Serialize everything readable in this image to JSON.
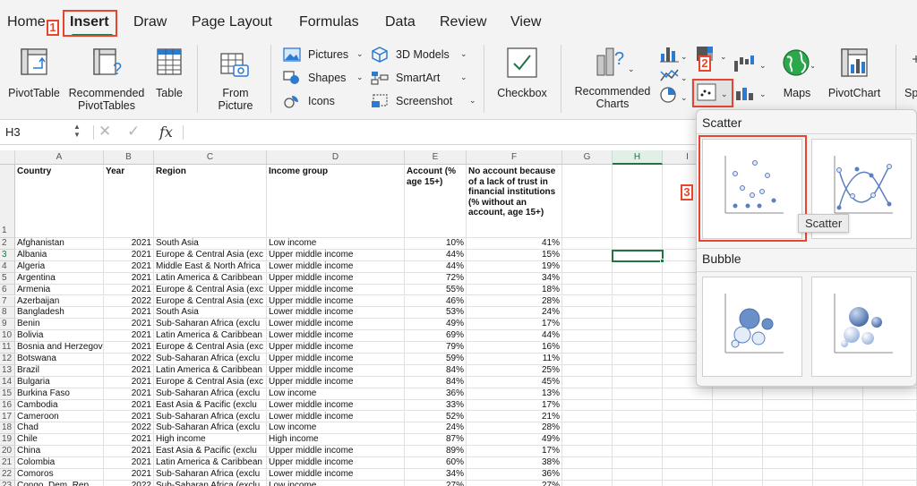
{
  "tabs": [
    "Home",
    "Insert",
    "Draw",
    "Page Layout",
    "Formulas",
    "Data",
    "Review",
    "View"
  ],
  "ribbon": {
    "pivot_table": "PivotTable",
    "recommended_pivot_1": "Recommended",
    "recommended_pivot_2": "PivotTables",
    "table": "Table",
    "from_picture_1": "From",
    "from_picture_2": "Picture",
    "pictures": "Pictures",
    "shapes": "Shapes",
    "icons": "Icons",
    "models_3d": "3D Models",
    "smartart": "SmartArt",
    "screenshot": "Screenshot",
    "checkbox": "Checkbox",
    "recommended_charts_1": "Recommended",
    "recommended_charts_2": "Charts",
    "maps": "Maps",
    "pivot_chart": "PivotChart",
    "sp": "Sp"
  },
  "formula_bar": {
    "name_box": "H3",
    "fx": "fx"
  },
  "columns": [
    "A",
    "B",
    "C",
    "D",
    "E",
    "F",
    "G",
    "H",
    "I"
  ],
  "headers": {
    "country": "Country",
    "year": "Year",
    "region": "Region",
    "income": "Income group",
    "account": "Account (% age 15+)",
    "no_account": "No account because of a lack of trust in financial institutions (% without an account, age 15+)"
  },
  "rows": [
    {
      "n": "2",
      "country": "Afghanistan",
      "year": "2021",
      "region": "South Asia",
      "income": "Low income",
      "account": "10%",
      "no_account": "41%"
    },
    {
      "n": "3",
      "country": "Albania",
      "year": "2021",
      "region": "Europe & Central Asia (exc",
      "income": "Upper middle income",
      "account": "44%",
      "no_account": "15%"
    },
    {
      "n": "4",
      "country": "Algeria",
      "year": "2021",
      "region": "Middle East & North Africa",
      "income": "Lower middle income",
      "account": "44%",
      "no_account": "19%"
    },
    {
      "n": "5",
      "country": "Argentina",
      "year": "2021",
      "region": "Latin America & Caribbean",
      "income": "Upper middle income",
      "account": "72%",
      "no_account": "34%"
    },
    {
      "n": "6",
      "country": "Armenia",
      "year": "2021",
      "region": "Europe & Central Asia (exc",
      "income": "Upper middle income",
      "account": "55%",
      "no_account": "18%"
    },
    {
      "n": "7",
      "country": "Azerbaijan",
      "year": "2022",
      "region": "Europe & Central Asia (exc",
      "income": "Upper middle income",
      "account": "46%",
      "no_account": "28%"
    },
    {
      "n": "8",
      "country": "Bangladesh",
      "year": "2021",
      "region": "South Asia",
      "income": "Lower middle income",
      "account": "53%",
      "no_account": "24%"
    },
    {
      "n": "9",
      "country": "Benin",
      "year": "2021",
      "region": "Sub-Saharan Africa (exclu",
      "income": "Lower middle income",
      "account": "49%",
      "no_account": "17%"
    },
    {
      "n": "10",
      "country": "Bolivia",
      "year": "2021",
      "region": "Latin America & Caribbean",
      "income": "Lower middle income",
      "account": "69%",
      "no_account": "44%"
    },
    {
      "n": "11",
      "country": "Bosnia and Herzegov",
      "year": "2021",
      "region": "Europe & Central Asia (exc",
      "income": "Upper middle income",
      "account": "79%",
      "no_account": "16%"
    },
    {
      "n": "12",
      "country": "Botswana",
      "year": "2022",
      "region": "Sub-Saharan Africa (exclu",
      "income": "Upper middle income",
      "account": "59%",
      "no_account": "11%"
    },
    {
      "n": "13",
      "country": "Brazil",
      "year": "2021",
      "region": "Latin America & Caribbean",
      "income": "Upper middle income",
      "account": "84%",
      "no_account": "25%"
    },
    {
      "n": "14",
      "country": "Bulgaria",
      "year": "2021",
      "region": "Europe & Central Asia (exc",
      "income": "Upper middle income",
      "account": "84%",
      "no_account": "45%"
    },
    {
      "n": "15",
      "country": "Burkina Faso",
      "year": "2021",
      "region": "Sub-Saharan Africa (exclu",
      "income": "Low income",
      "account": "36%",
      "no_account": "13%"
    },
    {
      "n": "16",
      "country": "Cambodia",
      "year": "2021",
      "region": "East Asia & Pacific (exclu",
      "income": "Lower middle income",
      "account": "33%",
      "no_account": "17%"
    },
    {
      "n": "17",
      "country": "Cameroon",
      "year": "2021",
      "region": "Sub-Saharan Africa (exclu",
      "income": "Lower middle income",
      "account": "52%",
      "no_account": "21%"
    },
    {
      "n": "18",
      "country": "Chad",
      "year": "2022",
      "region": "Sub-Saharan Africa (exclu",
      "income": "Low income",
      "account": "24%",
      "no_account": "28%"
    },
    {
      "n": "19",
      "country": "Chile",
      "year": "2021",
      "region": "High income",
      "income": "High income",
      "account": "87%",
      "no_account": "49%"
    },
    {
      "n": "20",
      "country": "China",
      "year": "2021",
      "region": "East Asia & Pacific (exclu",
      "income": "Upper middle income",
      "account": "89%",
      "no_account": "17%"
    },
    {
      "n": "21",
      "country": "Colombia",
      "year": "2021",
      "region": "Latin America & Caribbean",
      "income": "Upper middle income",
      "account": "60%",
      "no_account": "38%"
    },
    {
      "n": "22",
      "country": "Comoros",
      "year": "2021",
      "region": "Sub-Saharan Africa (exclu",
      "income": "Lower middle income",
      "account": "34%",
      "no_account": "36%"
    },
    {
      "n": "23",
      "country": "Congo, Dem. Rep.",
      "year": "2022",
      "region": "Sub-Saharan Africa (exclu",
      "income": "Low income",
      "account": "27%",
      "no_account": "27%"
    }
  ],
  "dropdown": {
    "scatter_heading": "Scatter",
    "bubble_heading": "Bubble",
    "tooltip": "Scatter"
  },
  "annotations": [
    "1",
    "2",
    "3"
  ],
  "colors": {
    "accent": "#217346",
    "annotation": "#e8452c",
    "marker": "#5b7fbf"
  }
}
